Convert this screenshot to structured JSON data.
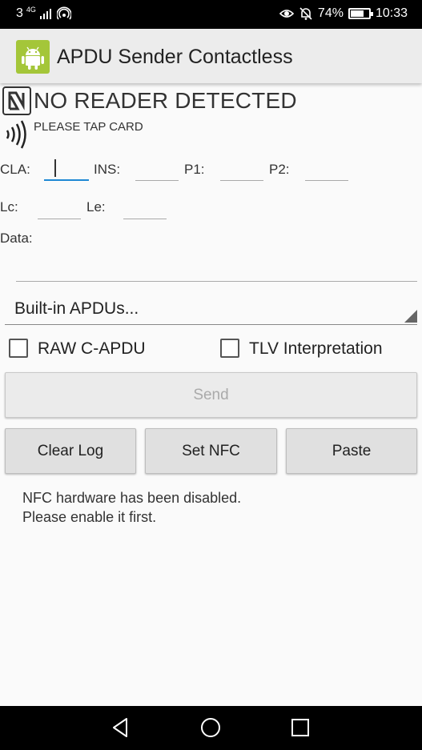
{
  "status_bar": {
    "carrier": "3",
    "network": "4G",
    "battery_text": "74%",
    "battery_level": 0.74,
    "time": "10:33",
    "icons": [
      "signal-icon",
      "hotspot-icon",
      "eye-icon",
      "bell-muted-icon",
      "battery-icon"
    ]
  },
  "app_bar": {
    "title": "APDU Sender Contactless",
    "icon": "android-icon",
    "icon_color": "#a4c639"
  },
  "reader": {
    "status": "NO READER DETECTED",
    "hint": "PLEASE TAP CARD"
  },
  "fields": {
    "cla_label": "CLA:",
    "ins_label": "INS:",
    "p1_label": "P1:",
    "p2_label": "P2:",
    "lc_label": "Lc:",
    "le_label": "Le:",
    "data_label": "Data:",
    "cla_value": "",
    "ins_value": "",
    "p1_value": "",
    "p2_value": "",
    "lc_value": "",
    "le_value": "",
    "data_value": ""
  },
  "builtin_spinner": {
    "label": "Built-in APDUs..."
  },
  "options": {
    "raw_label": "RAW C-APDU",
    "raw_checked": false,
    "tlv_label": "TLV Interpretation",
    "tlv_checked": false
  },
  "buttons": {
    "send": "Send",
    "clear_log": "Clear Log",
    "set_nfc": "Set NFC",
    "paste": "Paste"
  },
  "log": {
    "line1": "NFC hardware has been disabled.",
    "line2": "Please enable it first."
  },
  "accent_color": "#1e88d4",
  "nav_bar": {
    "icons": [
      "back-icon",
      "home-icon",
      "recents-icon"
    ]
  }
}
